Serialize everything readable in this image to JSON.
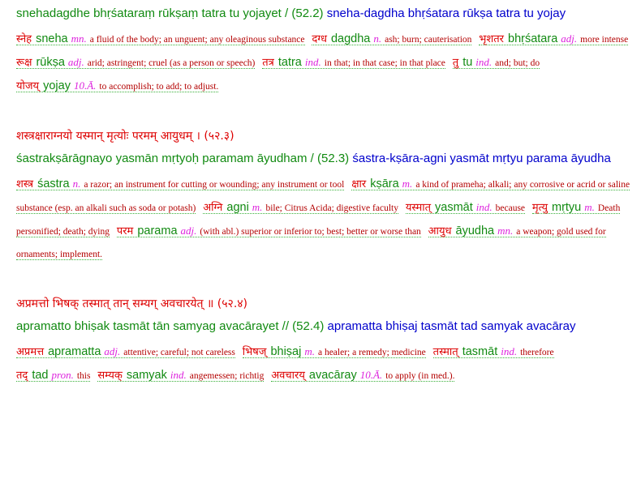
{
  "blocks": [
    {
      "devanagari": "",
      "transliteration": "snehadagdhe bhṛśataraṃ rūkṣaṃ tatra tu yojayet / (52.2)",
      "parsed": "sneha-dagdha bhṛśatara rūkṣa tatra tu yojay",
      "words": [
        {
          "deva": "स्नेह",
          "roman": "sneha",
          "pos": "mn.",
          "def": "a fluid of the body; an unguent; any oleaginous substance"
        },
        {
          "deva": "दग्ध",
          "roman": "dagdha",
          "pos": "n.",
          "def": "ash; burn; cauterisation"
        },
        {
          "deva": "भृशतर",
          "roman": "bhṛśatara",
          "pos": "adj.",
          "def": "more intense"
        },
        {
          "deva": "रूक्ष",
          "roman": "rūkṣa",
          "pos": "adj.",
          "def": "arid; astringent; cruel (as a person or speech)"
        },
        {
          "deva": "तत्र",
          "roman": "tatra",
          "pos": "ind.",
          "def": "in that; in that case; in that place"
        },
        {
          "deva": "तु",
          "roman": "tu",
          "pos": "ind.",
          "def": "and; but; do"
        },
        {
          "deva": "योजय्",
          "roman": "yojay",
          "pos": "10.Ā.",
          "def": "to accomplish; to add; to adjust."
        }
      ]
    },
    {
      "devanagari": "शस्त्रक्षाराग्नयो यस्मान् मृत्योः परमम् आयुधम् । (५२.३)",
      "transliteration": "śastrakṣārāgnayo yasmān mṛtyoḥ paramam āyudham / (52.3)",
      "parsed": "śastra-kṣāra-agni yasmāt mṛtyu parama āyudha",
      "words": [
        {
          "deva": "शस्त्र",
          "roman": "śastra",
          "pos": "n.",
          "def": "a razor; an instrument for cutting or wounding; any instrument or tool"
        },
        {
          "deva": "क्षार",
          "roman": "kṣāra",
          "pos": "m.",
          "def": "a kind of prameha; alkali; any corrosive or acrid or saline substance (esp. an alkali such as soda or potash)"
        },
        {
          "deva": "अग्नि",
          "roman": "agni",
          "pos": "m.",
          "def": "bile; Citrus Acida; digestive faculty"
        },
        {
          "deva": "यस्मात्",
          "roman": "yasmāt",
          "pos": "ind.",
          "def": "because"
        },
        {
          "deva": "मृत्यु",
          "roman": "mṛtyu",
          "pos": "m.",
          "def": "Death personified; death; dying"
        },
        {
          "deva": "परम",
          "roman": "parama",
          "pos": "adj.",
          "def": "(with abl.) superior or inferior to; best; better or worse than"
        },
        {
          "deva": "आयुध",
          "roman": "āyudha",
          "pos": "mn.",
          "def": "a weapon; gold used for ornaments; implement."
        }
      ]
    },
    {
      "devanagari": "अप्रमत्तो भिषक् तस्मात् तान् सम्यग् अवचारयेत् ॥ (५२.४)",
      "transliteration": "apramatto bhiṣak tasmāt tān samyag avacārayet // (52.4)",
      "parsed": "apramatta bhiṣaj tasmāt tad samyak avacāray",
      "words": [
        {
          "deva": "अप्रमत्त",
          "roman": "apramatta",
          "pos": "adj.",
          "def": "attentive; careful; not careless"
        },
        {
          "deva": "भिषज्",
          "roman": "bhiṣaj",
          "pos": "m.",
          "def": "a healer; a remedy; medicine"
        },
        {
          "deva": "तस्मात्",
          "roman": "tasmāt",
          "pos": "ind.",
          "def": "therefore"
        },
        {
          "deva": "तद्",
          "roman": "tad",
          "pos": "pron.",
          "def": "this"
        },
        {
          "deva": "सम्यक्",
          "roman": "samyak",
          "pos": "ind.",
          "def": "angemessen; richtig"
        },
        {
          "deva": "अवचारय्",
          "roman": "avacāray",
          "pos": "10.Ā.",
          "def": "to apply (in med.)."
        }
      ]
    }
  ]
}
